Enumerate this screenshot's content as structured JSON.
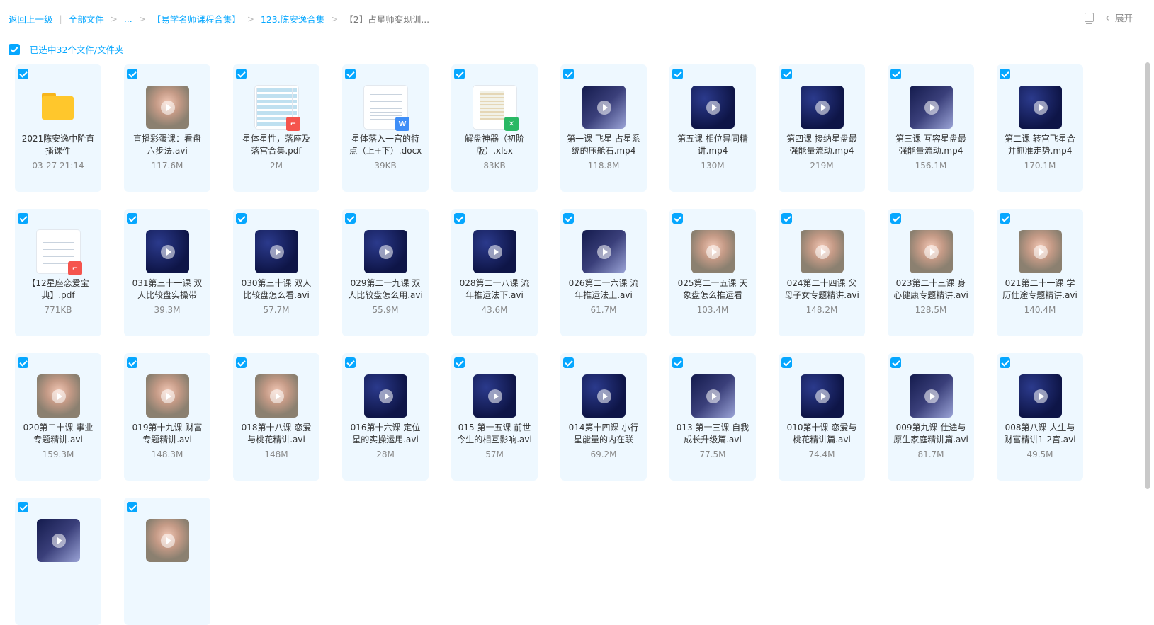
{
  "breadcrumb": {
    "back": "返回上一级",
    "items": [
      "全部文件",
      "...",
      "【易学名师课程合集】",
      "123.陈安逸合集"
    ],
    "current": "【2】占星师变现训..."
  },
  "top_right": {
    "expand_label": "展开"
  },
  "selection": {
    "text": "已选中32个文件/文件夹"
  },
  "files": [
    {
      "name": "2021陈安逸中阶直播课件",
      "meta": "03-27 21:14",
      "kind": "folder"
    },
    {
      "name": "直播彩蛋课：看盘六步法.avi",
      "meta": "117.6M",
      "kind": "video",
      "style": "person"
    },
    {
      "name": "星体星性，落座及落宫合集.pdf",
      "meta": "2M",
      "kind": "pdf",
      "style": "table"
    },
    {
      "name": "星体落入一宫的特点（上+下）.docx",
      "meta": "39KB",
      "kind": "word"
    },
    {
      "name": "解盘神器（初阶版）.xlsx",
      "meta": "83KB",
      "kind": "xls",
      "style": "sheet"
    },
    {
      "name": "第一课 飞星 占星系统的压舱石.mp4",
      "meta": "118.8M",
      "kind": "video",
      "style": "mix"
    },
    {
      "name": "第五课 相位异同精讲.mp4",
      "meta": "130M",
      "kind": "video"
    },
    {
      "name": "第四课 接纳星盘最强能量流动.mp4",
      "meta": "219M",
      "kind": "video"
    },
    {
      "name": "第三课 互容星盘最强能量流动.mp4",
      "meta": "156.1M",
      "kind": "video",
      "style": "mix"
    },
    {
      "name": "第二课 转宫飞星合并抓准走势.mp4",
      "meta": "170.1M",
      "kind": "video"
    },
    {
      "name": "【12星座恋爱宝典】.pdf",
      "meta": "771KB",
      "kind": "pdf"
    },
    {
      "name": "031第三十一课 双人比较盘实操带",
      "meta": "39.3M",
      "kind": "video"
    },
    {
      "name": "030第三十课 双人比较盘怎么看.avi",
      "meta": "57.7M",
      "kind": "video"
    },
    {
      "name": "029第二十九课 双人比较盘怎么用.avi",
      "meta": "55.9M",
      "kind": "video"
    },
    {
      "name": "028第二十八课 流年推运法下.avi",
      "meta": "43.6M",
      "kind": "video"
    },
    {
      "name": "026第二十六课 流年推运法上.avi",
      "meta": "61.7M",
      "kind": "video",
      "style": "mix"
    },
    {
      "name": "025第二十五课 天象盘怎么推运看",
      "meta": "103.4M",
      "kind": "video",
      "style": "person"
    },
    {
      "name": "024第二十四课 父母子女专题精讲.avi",
      "meta": "148.2M",
      "kind": "video",
      "style": "person"
    },
    {
      "name": "023第二十三课 身心健康专题精讲.avi",
      "meta": "128.5M",
      "kind": "video",
      "style": "person"
    },
    {
      "name": "021第二十一课 学历仕途专题精讲.avi",
      "meta": "140.4M",
      "kind": "video",
      "style": "person"
    },
    {
      "name": "020第二十课 事业专题精讲.avi",
      "meta": "159.3M",
      "kind": "video",
      "style": "person"
    },
    {
      "name": "019第十九课 财富专题精讲.avi",
      "meta": "148.3M",
      "kind": "video",
      "style": "person"
    },
    {
      "name": "018第十八课 恋爱与桃花精讲.avi",
      "meta": "148M",
      "kind": "video",
      "style": "person"
    },
    {
      "name": "016第十六课 定位星的实操运用.avi",
      "meta": "28M",
      "kind": "video"
    },
    {
      "name": "015 第十五课 前世今生的相互影响.avi",
      "meta": "57M",
      "kind": "video"
    },
    {
      "name": "014第十四课 小行星能量的内在联",
      "meta": "69.2M",
      "kind": "video"
    },
    {
      "name": "013 第十三课 自我成长升级篇.avi",
      "meta": "77.5M",
      "kind": "video",
      "style": "mix"
    },
    {
      "name": "010第十课 恋爱与桃花精讲篇.avi",
      "meta": "74.4M",
      "kind": "video"
    },
    {
      "name": "009第九课 仕途与原生家庭精讲篇.avi",
      "meta": "81.7M",
      "kind": "video",
      "style": "mix"
    },
    {
      "name": "008第八课 人生与财富精讲1-2宫.avi",
      "meta": "49.5M",
      "kind": "video"
    },
    {
      "name": "",
      "meta": "",
      "kind": "video",
      "style": "mix"
    },
    {
      "name": "",
      "meta": "",
      "kind": "video",
      "style": "person"
    }
  ]
}
